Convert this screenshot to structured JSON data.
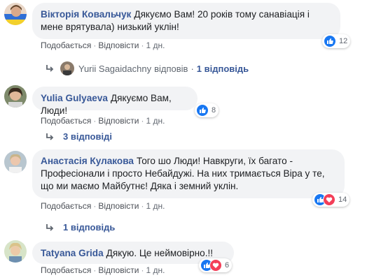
{
  "comments": [
    {
      "author": "Вікторія Ковальчук",
      "text": "Дякуємо Вам! 20 років тому санавіація і мене врятувала) низький уклін!",
      "like_label": "Подобається",
      "reply_label": "Відповісти",
      "time": "1 дн.",
      "reaction_count": "12",
      "reply_summary": {
        "author": "Yurii Sagaidachny",
        "replied": "відповів",
        "dot": "·",
        "count": "1 відповідь"
      }
    },
    {
      "author": "Yulia Gulyaeva",
      "text": "Дякуємо Вам, Люди!",
      "reaction_count": "8",
      "like_label": "Подобається",
      "reply_label": "Відповісти",
      "time": "1 дн.",
      "replies_label": "3 відповіді"
    },
    {
      "author": "Анастасія Кулакова",
      "text": "Того шо Люди! Навкруги, їх багато - Професіонали і просто Небайдужі. На них тримається Віра у те, що ми маємо Майбутнє! Дяка і земний уклін.",
      "reaction_count": "14",
      "like_label": "Подобається",
      "reply_label": "Відповісти",
      "time": "1 дн.",
      "replies_label": "1 відповідь"
    },
    {
      "author": "Tatyana Grida",
      "text": "Дякую. Це неймовірно.!!",
      "reaction_count": "6",
      "like_label": "Подобається",
      "reply_label": "Відповісти",
      "time": "1 дн."
    }
  ],
  "separator": "·",
  "colors": {
    "link": "#385898",
    "bubble": "#f2f3f5",
    "like": "#1877f2",
    "love": "#f33e58"
  }
}
